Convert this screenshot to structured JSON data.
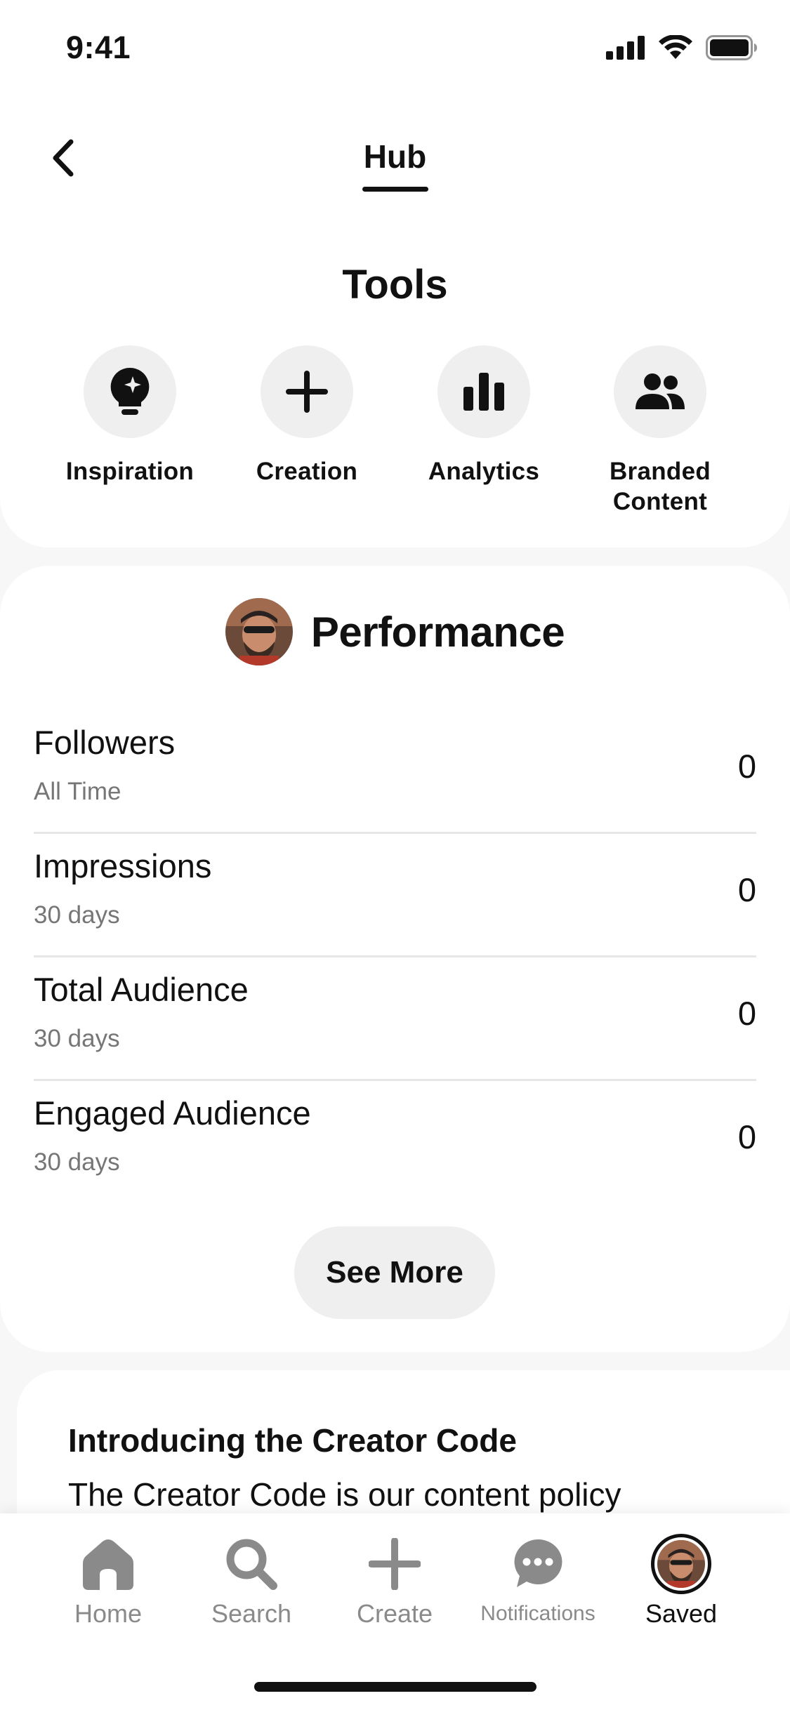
{
  "status_bar": {
    "time": "9:41"
  },
  "header": {
    "back_icon": "chevron-left-icon",
    "active_tab": "Hub"
  },
  "tools": {
    "title": "Tools",
    "items": [
      {
        "label": "Inspiration",
        "icon": "lightbulb-sparkle-icon"
      },
      {
        "label": "Creation",
        "icon": "plus-icon"
      },
      {
        "label": "Analytics",
        "icon": "bar-chart-icon"
      },
      {
        "label": "Branded Content",
        "icon": "people-icon"
      }
    ]
  },
  "performance": {
    "title": "Performance",
    "metrics": [
      {
        "name": "Followers",
        "period": "All Time",
        "value": "0"
      },
      {
        "name": "Impressions",
        "period": "30 days",
        "value": "0"
      },
      {
        "name": "Total Audience",
        "period": "30 days",
        "value": "0"
      },
      {
        "name": "Engaged Audience",
        "period": "30 days",
        "value": "0"
      }
    ],
    "see_more_label": "See More"
  },
  "creator_code": {
    "title": "Introducing the Creator Code",
    "body": "The Creator Code is our content policy"
  },
  "bottom_nav": {
    "items": [
      {
        "label": "Home",
        "icon": "home-icon"
      },
      {
        "label": "Search",
        "icon": "search-icon"
      },
      {
        "label": "Create",
        "icon": "plus-icon"
      },
      {
        "label": "Notifications",
        "icon": "chat-bubble-icon"
      },
      {
        "label": "Saved",
        "icon": "profile-avatar",
        "active": true
      }
    ]
  },
  "colors": {
    "text": "#111111",
    "secondary_text": "#767676",
    "nav_inactive": "#8a8a8a",
    "circle_bg": "#efefef",
    "page_bg": "#f7f7f7"
  }
}
